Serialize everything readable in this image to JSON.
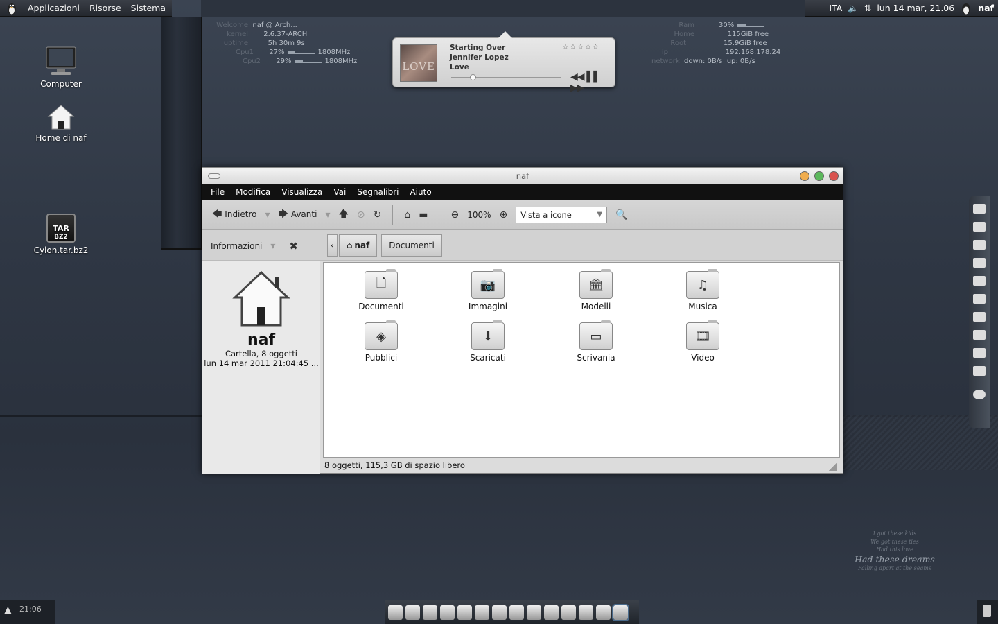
{
  "top_panel": {
    "menus": [
      "Applicazioni",
      "Risorse",
      "Sistema"
    ],
    "keyboard": "ITA",
    "clock": "lun 14 mar, 21.06",
    "user": "naf"
  },
  "conky_left": {
    "welcome_label": "Welcome",
    "welcome_value": "naf @ Arch...",
    "kernel_label": "kernel",
    "kernel_value": "2.6.37-ARCH",
    "uptime_label": "uptime",
    "uptime_value": "5h 30m 9s",
    "cpu1_label": "Cpu1",
    "cpu1_pct": "27%",
    "cpu1_level": 0.27,
    "cpu1_freq": "1808MHz",
    "cpu2_label": "Cpu2",
    "cpu2_pct": "29%",
    "cpu2_level": 0.29,
    "cpu2_freq": "1808MHz"
  },
  "conky_right": {
    "ram_label": "Ram",
    "ram_pct": "30%",
    "ram_level": 0.3,
    "home_label": "Home",
    "home_value": "115GiB free",
    "root_label": "Root",
    "root_value": "15.9GiB free",
    "ip_label": "ip",
    "ip_value": "192.168.178.24",
    "network_label": "network",
    "down_value": "down: 0B/s",
    "up_value": "up: 0B/s"
  },
  "music": {
    "title": "Starting Over",
    "artist": "Jennifer Lopez",
    "album": "Love",
    "cover_text": "LOVE",
    "rating": "☆☆☆☆☆",
    "progress": 0.17
  },
  "desktop_icons": [
    {
      "label": "Computer"
    },
    {
      "label": "Home di naf"
    },
    {
      "label": "Cylon.tar.bz2",
      "badge_top": "TAR",
      "badge_bottom": "BZ2"
    }
  ],
  "window": {
    "title": "naf",
    "menu": [
      "File",
      "Modifica",
      "Visualizza",
      "Vai",
      "Segnalibri",
      "Aiuto"
    ],
    "toolbar": {
      "back": "Indietro",
      "forward": "Avanti",
      "zoom": "100%",
      "view_mode": "Vista a icone"
    },
    "side_pane_label": "Informazioni",
    "breadcrumbs": [
      "naf",
      "Documenti"
    ],
    "sidebar": {
      "name": "naf",
      "type": "Cartella, 8 oggetti",
      "date": "lun 14 mar 2011 21:04:45 ..."
    },
    "items": [
      {
        "label": "Documenti",
        "icon": "document-icon"
      },
      {
        "label": "Immagini",
        "icon": "camera-icon"
      },
      {
        "label": "Modelli",
        "icon": "building-icon"
      },
      {
        "label": "Musica",
        "icon": "music-icon"
      },
      {
        "label": "Pubblici",
        "icon": "public-icon"
      },
      {
        "label": "Scaricati",
        "icon": "download-icon"
      },
      {
        "label": "Scrivania",
        "icon": "desktop-icon"
      },
      {
        "label": "Video",
        "icon": "film-icon"
      }
    ],
    "status": "8 oggetti, 115,3 GB di spazio libero"
  },
  "bottom_panel": {
    "clock": "21:06"
  },
  "lyrics": {
    "line1": "I got these kids",
    "line2": "We got these ties",
    "line3": "Had this love",
    "line4": "Had these dreams",
    "line5": "Falling apart at the seams"
  },
  "colors": {
    "accent_close": "#d9534f",
    "accent_max": "#5cb85c",
    "accent_min": "#f0ad4e"
  }
}
